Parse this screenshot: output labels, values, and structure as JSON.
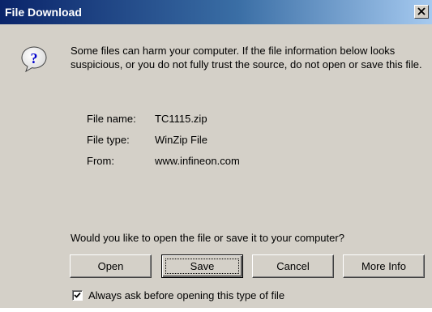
{
  "window": {
    "title": "File Download"
  },
  "message": {
    "warning": "Some files can harm your computer. If the file information below looks suspicious, or you do not fully trust the source, do not open or save this file."
  },
  "file_info": {
    "name_label": "File name:",
    "name_value": "TC1115.zip",
    "type_label": "File type:",
    "type_value": "WinZip File",
    "from_label": "From:",
    "from_value": "www.infineon.com"
  },
  "question": "Would you like to open the file or save it to your computer?",
  "buttons": {
    "open": "Open",
    "save": "Save",
    "cancel": "Cancel",
    "more_info": "More Info"
  },
  "checkbox": {
    "label": "Always ask before opening this type of file",
    "checked": true
  },
  "icons": {
    "title_close": "close-icon",
    "message": "question-icon",
    "check": "checkmark-icon"
  },
  "colors": {
    "titlebar_start": "#0a246a",
    "titlebar_end": "#a6caf0",
    "dialog_bg": "#d4d0c8"
  }
}
